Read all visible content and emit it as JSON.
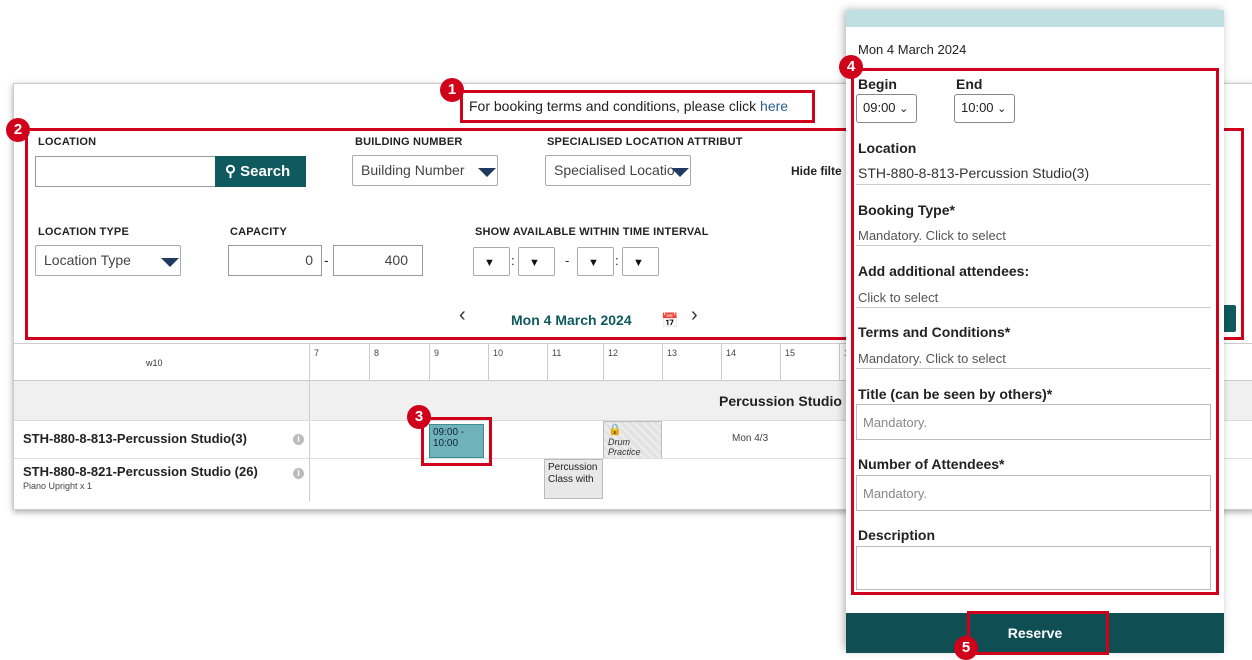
{
  "terms": {
    "text": "For booking terms and conditions, please click ",
    "link": "here"
  },
  "filters": {
    "location_label": "LOCATION",
    "search_label": "Search",
    "building_label": "BUILDING NUMBER",
    "building_placeholder": "Building Number",
    "specialised_label": "SPECIALISED LOCATION ATTRIBUT",
    "specialised_placeholder": "Specialised Locatio",
    "hide_filter": "Hide filte",
    "location_type_label": "LOCATION TYPE",
    "location_type_placeholder": "Location Type",
    "capacity_label": "CAPACITY",
    "capacity_min": "0",
    "capacity_max": "400",
    "interval_label": "SHOW AVAILABLE WITHIN TIME INTERVAL"
  },
  "date_nav": {
    "date": "Mon 4 March 2024"
  },
  "calendar": {
    "week": "w10",
    "hours": [
      "7",
      "8",
      "9",
      "10",
      "11",
      "12",
      "13",
      "14",
      "15",
      "1"
    ],
    "section_title": "Percussion Studio",
    "rows": [
      {
        "name": "STH-880-8-813-Percussion Studio(3)",
        "sub": ""
      },
      {
        "name": "STH-880-8-821-Percussion Studio (26)",
        "sub": "Piano Upright x 1"
      }
    ],
    "selected_slot": "09:00 - 10:00",
    "drum_label": "Drum Practice",
    "day_label": "Mon 4/3",
    "class_label": "Percussion Class with"
  },
  "panel": {
    "date": "Mon 4 March 2024",
    "begin_label": "Begin",
    "begin_value": "09:00",
    "end_label": "End",
    "end_value": "10:00",
    "location_label": "Location",
    "location_value": "STH-880-8-813-Percussion Studio(3)",
    "booking_type_label": "Booking Type*",
    "booking_type_value": "Mandatory. Click to select",
    "attendees_label": "Add additional attendees:",
    "attendees_value": "Click to select",
    "terms_label": "Terms and Conditions*",
    "terms_value": "Mandatory. Click to select",
    "title_label": "Title (can be seen by others)*",
    "title_placeholder": "Mandatory.",
    "num_label": "Number of Attendees*",
    "num_placeholder": "Mandatory.",
    "desc_label": "Description",
    "reserve": "Reserve"
  },
  "badges": [
    "1",
    "2",
    "3",
    "4",
    "5"
  ],
  "colors": {
    "accent": "#0f5a5f",
    "highlight": "#d0021b",
    "slot": "#6fb3b8",
    "panel_top": "#bfe0e0"
  }
}
